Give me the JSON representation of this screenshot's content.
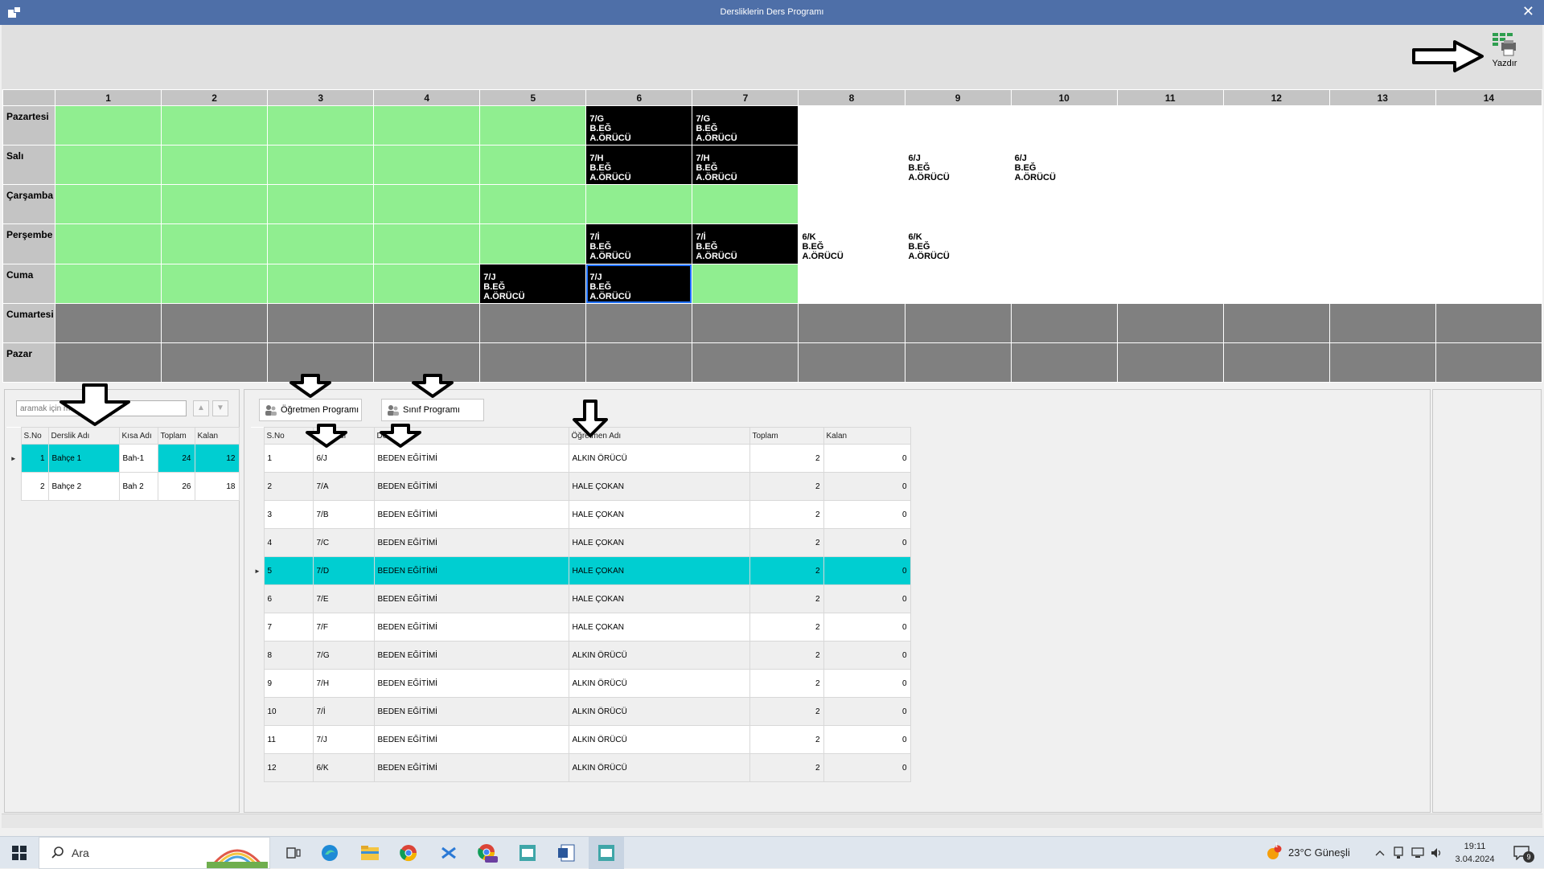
{
  "window": {
    "title": "Dersliklerin Ders Programı",
    "close_glyph": "✕"
  },
  "toolbar": {
    "print_label": "Yazdır",
    "print_icon": "printer-grid-icon"
  },
  "schedule": {
    "periods": [
      "1",
      "2",
      "3",
      "4",
      "5",
      "6",
      "7",
      "8",
      "9",
      "10",
      "11",
      "12",
      "13",
      "14"
    ],
    "days": [
      "Pazartesi",
      "Salı",
      "Çarşamba",
      "Perşembe",
      "Cuma",
      "Cumartesi",
      "Pazar"
    ],
    "rows": [
      [
        {
          "s": "g"
        },
        {
          "s": "g"
        },
        {
          "s": "g"
        },
        {
          "s": "g"
        },
        {
          "s": "g"
        },
        {
          "s": "k",
          "t": [
            "7/G",
            "B.EĞ",
            "A.ÖRÜCÜ"
          ]
        },
        {
          "s": "k",
          "t": [
            "7/G",
            "B.EĞ",
            "A.ÖRÜCÜ"
          ]
        },
        {
          "s": "w"
        },
        {
          "s": "w"
        },
        {
          "s": "w"
        },
        {
          "s": "w"
        },
        {
          "s": "w"
        },
        {
          "s": "w"
        },
        {
          "s": "w"
        }
      ],
      [
        {
          "s": "g"
        },
        {
          "s": "g"
        },
        {
          "s": "g"
        },
        {
          "s": "g"
        },
        {
          "s": "g"
        },
        {
          "s": "k",
          "t": [
            "7/H",
            "B.EĞ",
            "A.ÖRÜCÜ"
          ]
        },
        {
          "s": "k",
          "t": [
            "7/H",
            "B.EĞ",
            "A.ÖRÜCÜ"
          ]
        },
        {
          "s": "w"
        },
        {
          "s": "w",
          "t": [
            "6/J",
            "B.EĞ",
            "A.ÖRÜCÜ"
          ]
        },
        {
          "s": "w",
          "t": [
            "6/J",
            "B.EĞ",
            "A.ÖRÜCÜ"
          ]
        },
        {
          "s": "w"
        },
        {
          "s": "w"
        },
        {
          "s": "w"
        },
        {
          "s": "w"
        }
      ],
      [
        {
          "s": "g"
        },
        {
          "s": "g"
        },
        {
          "s": "g"
        },
        {
          "s": "g"
        },
        {
          "s": "g"
        },
        {
          "s": "g"
        },
        {
          "s": "g"
        },
        {
          "s": "w"
        },
        {
          "s": "w"
        },
        {
          "s": "w"
        },
        {
          "s": "w"
        },
        {
          "s": "w"
        },
        {
          "s": "w"
        },
        {
          "s": "w"
        }
      ],
      [
        {
          "s": "g"
        },
        {
          "s": "g"
        },
        {
          "s": "g"
        },
        {
          "s": "g"
        },
        {
          "s": "g"
        },
        {
          "s": "k",
          "t": [
            "7/İ",
            "B.EĞ",
            "A.ÖRÜCÜ"
          ]
        },
        {
          "s": "k",
          "t": [
            "7/İ",
            "B.EĞ",
            "A.ÖRÜCÜ"
          ]
        },
        {
          "s": "w",
          "t": [
            "6/K",
            "B.EĞ",
            "A.ÖRÜCÜ"
          ]
        },
        {
          "s": "w",
          "t": [
            "6/K",
            "B.EĞ",
            "A.ÖRÜCÜ"
          ]
        },
        {
          "s": "w"
        },
        {
          "s": "w"
        },
        {
          "s": "w"
        },
        {
          "s": "w"
        },
        {
          "s": "w"
        }
      ],
      [
        {
          "s": "g"
        },
        {
          "s": "g"
        },
        {
          "s": "g"
        },
        {
          "s": "g"
        },
        {
          "s": "k",
          "t": [
            "7/J",
            "B.EĞ",
            "A.ÖRÜCÜ"
          ]
        },
        {
          "s": "k",
          "sel": true,
          "t": [
            "7/J",
            "B.EĞ",
            "A.ÖRÜCÜ"
          ]
        },
        {
          "s": "g"
        },
        {
          "s": "w"
        },
        {
          "s": "w"
        },
        {
          "s": "w"
        },
        {
          "s": "w"
        },
        {
          "s": "w"
        },
        {
          "s": "w"
        },
        {
          "s": "w"
        }
      ],
      [
        {
          "s": "d"
        },
        {
          "s": "d"
        },
        {
          "s": "d"
        },
        {
          "s": "d"
        },
        {
          "s": "d"
        },
        {
          "s": "d"
        },
        {
          "s": "d"
        },
        {
          "s": "d"
        },
        {
          "s": "d"
        },
        {
          "s": "d"
        },
        {
          "s": "d"
        },
        {
          "s": "d"
        },
        {
          "s": "d"
        },
        {
          "s": "d"
        }
      ],
      [
        {
          "s": "d"
        },
        {
          "s": "d"
        },
        {
          "s": "d"
        },
        {
          "s": "d"
        },
        {
          "s": "d"
        },
        {
          "s": "d"
        },
        {
          "s": "d"
        },
        {
          "s": "d"
        },
        {
          "s": "d"
        },
        {
          "s": "d"
        },
        {
          "s": "d"
        },
        {
          "s": "d"
        },
        {
          "s": "d"
        },
        {
          "s": "d"
        }
      ]
    ],
    "colors": {
      "free": "#90ee90",
      "busy": "#000000",
      "empty": "#ffffff",
      "closed": "#808080",
      "selected_border": "#1e6fff"
    }
  },
  "left": {
    "search_placeholder": "aramak için metni girin",
    "up_glyph": "▲",
    "down_glyph": "▼",
    "columns": [
      "S.No",
      "Derslik Adı",
      "Kısa Adı",
      "Toplam",
      "Kalan"
    ],
    "rows": [
      [
        "1",
        "Bahçe 1",
        "Bah-1",
        "24",
        "12"
      ],
      [
        "2",
        "Bahçe 2",
        "Bah 2",
        "26",
        "18"
      ]
    ],
    "selected_index": 0
  },
  "middle": {
    "tabs": [
      {
        "label": "Öğretmen Programı",
        "icon": "teacher-icon"
      },
      {
        "label": "Sınıf Programı",
        "icon": "class-icon"
      }
    ],
    "columns": [
      "S.No",
      "Sınıf Adı",
      "Ders Adı",
      "Öğretmen Adı",
      "Toplam",
      "Kalan"
    ],
    "rows": [
      [
        "1",
        "6/J",
        "BEDEN EĞİTİMİ",
        "ALKIN ÖRÜCÜ",
        "2",
        "0"
      ],
      [
        "2",
        "7/A",
        "BEDEN EĞİTİMİ",
        "HALE ÇOKAN",
        "2",
        "0"
      ],
      [
        "3",
        "7/B",
        "BEDEN EĞİTİMİ",
        "HALE ÇOKAN",
        "2",
        "0"
      ],
      [
        "4",
        "7/C",
        "BEDEN EĞİTİMİ",
        "HALE ÇOKAN",
        "2",
        "0"
      ],
      [
        "5",
        "7/D",
        "BEDEN EĞİTİMİ",
        "HALE ÇOKAN",
        "2",
        "0"
      ],
      [
        "6",
        "7/E",
        "BEDEN EĞİTİMİ",
        "HALE ÇOKAN",
        "2",
        "0"
      ],
      [
        "7",
        "7/F",
        "BEDEN EĞİTİMİ",
        "HALE ÇOKAN",
        "2",
        "0"
      ],
      [
        "8",
        "7/G",
        "BEDEN EĞİTİMİ",
        "ALKIN ÖRÜCÜ",
        "2",
        "0"
      ],
      [
        "9",
        "7/H",
        "BEDEN EĞİTİMİ",
        "ALKIN ÖRÜCÜ",
        "2",
        "0"
      ],
      [
        "10",
        "7/İ",
        "BEDEN EĞİTİMİ",
        "ALKIN ÖRÜCÜ",
        "2",
        "0"
      ],
      [
        "11",
        "7/J",
        "BEDEN EĞİTİMİ",
        "ALKIN ÖRÜCÜ",
        "2",
        "0"
      ],
      [
        "12",
        "6/K",
        "BEDEN EĞİTİMİ",
        "ALKIN ÖRÜCÜ",
        "2",
        "0"
      ]
    ],
    "selected_index": 4,
    "highlight_color": "#00ced1"
  },
  "taskbar": {
    "search_text": "Ara",
    "weather": "23°C  Güneşli",
    "weather_badge": "1",
    "time": "19:11",
    "date": "3.04.2024",
    "notification_count": "9",
    "apps": [
      "task-view-icon",
      "edge-icon",
      "file-explorer-icon",
      "chrome-icon",
      "vscode-icon",
      "chrome-profile-icon",
      "app-icon",
      "word-icon",
      "app-icon-active"
    ]
  }
}
